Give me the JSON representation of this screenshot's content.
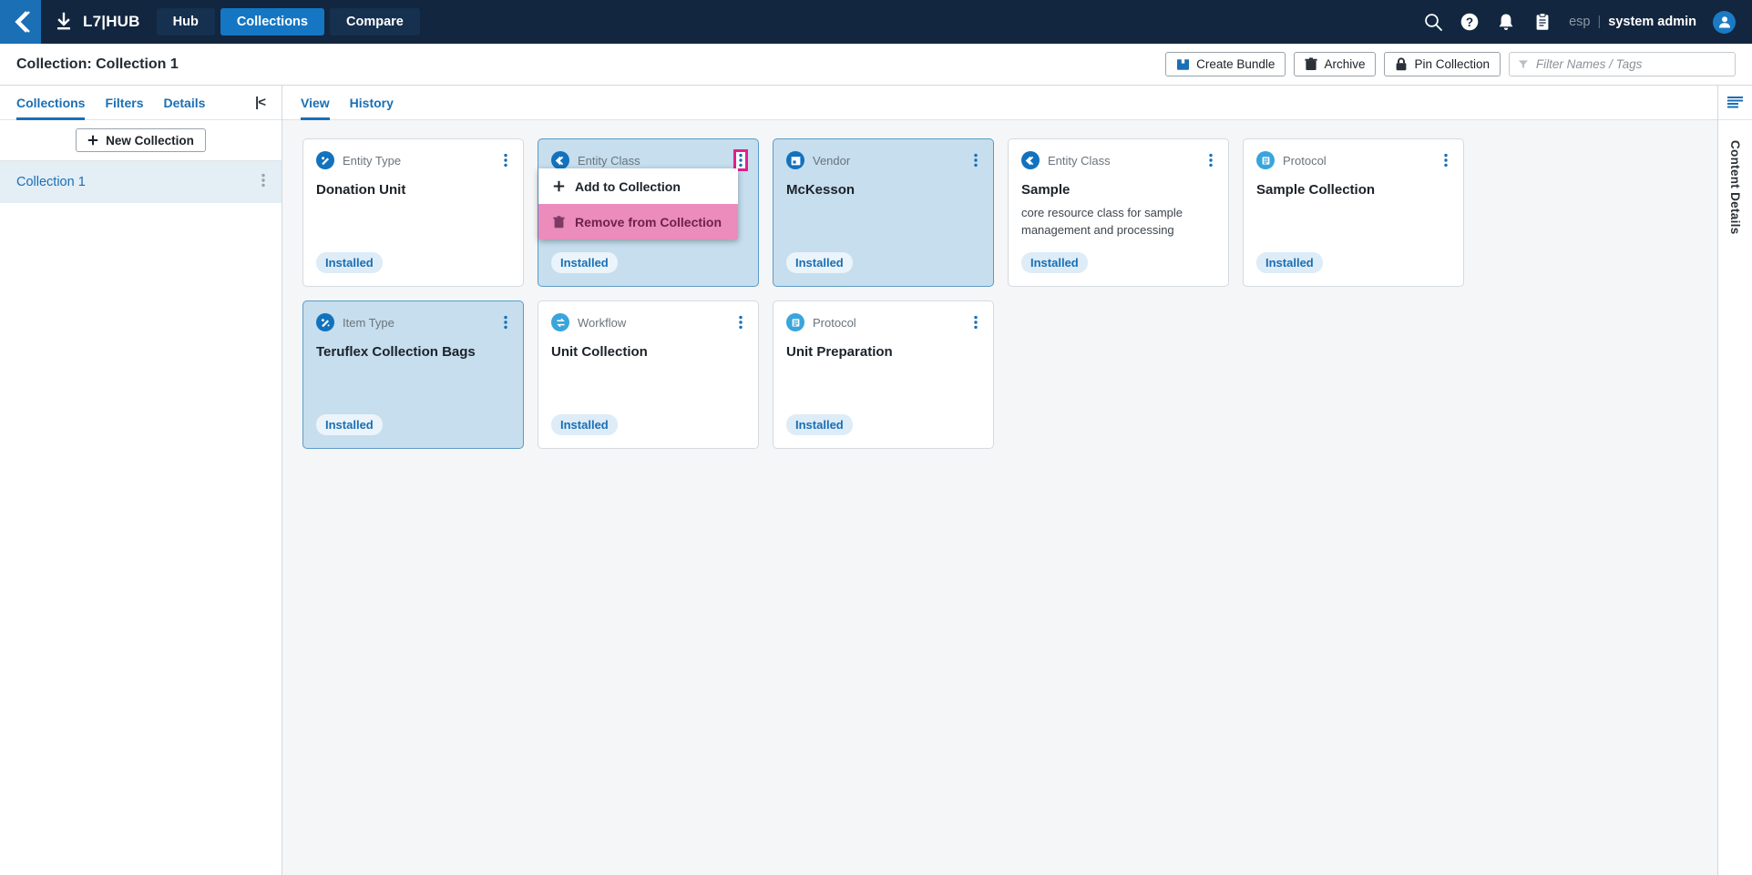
{
  "top_nav": {
    "back_icon": "chevron-left-icon",
    "brand": "L7|HUB",
    "brand_icon": "download-icon",
    "tabs": [
      {
        "label": "Hub",
        "active": false
      },
      {
        "label": "Collections",
        "active": true
      },
      {
        "label": "Compare",
        "active": false
      }
    ],
    "icons": [
      "search-icon",
      "help-icon",
      "notifications-icon",
      "clipboard-icon"
    ],
    "tenant": "esp",
    "separator": "|",
    "user_name": "system admin",
    "accent": "#1576c4",
    "background": "#12263f"
  },
  "sub_header": {
    "title": "Collection: Collection 1",
    "create_bundle": "Create Bundle",
    "archive": "Archive",
    "pin_collection": "Pin Collection",
    "filter_placeholder": "Filter Names / Tags",
    "filter_value": ""
  },
  "sidebar": {
    "tabs": [
      {
        "label": "Collections",
        "active": true
      },
      {
        "label": "Filters",
        "active": false
      },
      {
        "label": "Details",
        "active": false
      }
    ],
    "collapse_label": "|<",
    "new_collection": "New Collection",
    "collections": [
      {
        "name": "Collection 1",
        "selected": true
      }
    ]
  },
  "main": {
    "tabs": [
      {
        "label": "View",
        "active": true
      },
      {
        "label": "History",
        "active": false
      }
    ],
    "cards": [
      {
        "type": "Entity Type",
        "icon": "entity-type-icon",
        "icon_color": "#1272bd",
        "title": "Donation Unit",
        "description": "",
        "badge": "Installed",
        "selected": false,
        "menu_open": false
      },
      {
        "type": "Entity Class",
        "icon": "entity-class-icon",
        "icon_color": "#1272bd",
        "title": "",
        "description": "",
        "badge": "Installed",
        "selected": true,
        "menu_open": true
      },
      {
        "type": "Vendor",
        "icon": "vendor-icon",
        "icon_color": "#1272bd",
        "title": "McKesson",
        "description": "",
        "badge": "Installed",
        "selected": true,
        "menu_open": false
      },
      {
        "type": "Entity Class",
        "icon": "entity-class-icon",
        "icon_color": "#1272bd",
        "title": "Sample",
        "description": "core resource class for sample management and processing",
        "badge": "Installed",
        "selected": false,
        "menu_open": false
      },
      {
        "type": "Protocol",
        "icon": "protocol-icon",
        "icon_color": "#39a5dc",
        "title": "Sample Collection",
        "description": "",
        "badge": "Installed",
        "selected": false,
        "menu_open": false
      },
      {
        "type": "Item Type",
        "icon": "item-type-icon",
        "icon_color": "#1272bd",
        "title": "Teruflex Collection Bags",
        "description": "",
        "badge": "Installed",
        "selected": true,
        "menu_open": false
      },
      {
        "type": "Workflow",
        "icon": "workflow-icon",
        "icon_color": "#39a5dc",
        "title": "Unit Collection",
        "description": "",
        "badge": "Installed",
        "selected": false,
        "menu_open": false
      },
      {
        "type": "Protocol",
        "icon": "protocol-icon",
        "icon_color": "#39a5dc",
        "title": "Unit Preparation",
        "description": "",
        "badge": "Installed",
        "selected": false,
        "menu_open": false
      }
    ]
  },
  "context_menu": {
    "add_to_collection": "Add to Collection",
    "remove_from_collection": "Remove from Collection",
    "highlight_color": "#e0218a",
    "danger_background": "#eb8cbd"
  },
  "right_rail": {
    "panel_icon": "list-lines-icon",
    "label": "Content Details"
  }
}
